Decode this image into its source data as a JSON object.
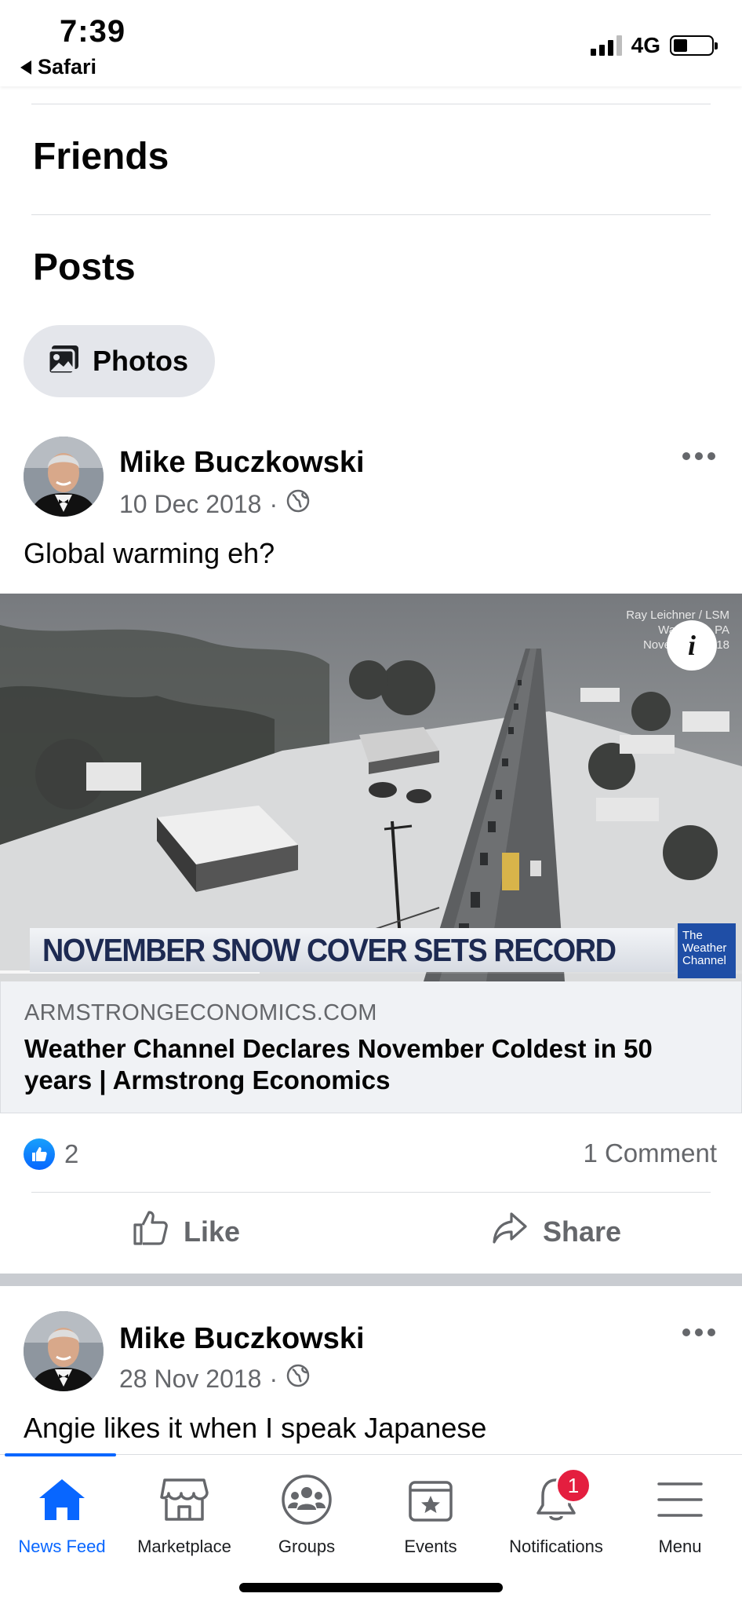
{
  "status_bar": {
    "time": "7:39",
    "back_app": "Safari",
    "network": "4G"
  },
  "profile_sections": {
    "friends": "Friends",
    "posts": "Posts",
    "photos_chip": "Photos"
  },
  "posts": [
    {
      "author": "Mike Buczkowski",
      "date": "10 Dec 2018",
      "separator": "·",
      "text": "Global warming eh?",
      "media": {
        "headline": "NOVEMBER SNOW COVER SETS RECORD",
        "credit_lines": [
          "Ray Leichner / LSM",
          "Wa            PA",
          "Novemb         18"
        ],
        "channel_logo": [
          "The",
          "Weather",
          "Channel"
        ],
        "info_label": "i",
        "video_progress": 0.35
      },
      "link": {
        "domain": "ARMSTRONGECONOMICS.COM",
        "title": "Weather Channel Declares November Coldest in 50 years | Armstrong Economics"
      },
      "reaction_count": "2",
      "comment_count": "1 Comment",
      "actions": {
        "like": "Like",
        "share": "Share"
      }
    },
    {
      "author": "Mike Buczkowski",
      "date": "28 Nov 2018",
      "separator": "·",
      "text": "Angie likes it when I speak Japanese"
    }
  ],
  "bottom_nav": {
    "items": [
      {
        "label": "News Feed",
        "icon": "home-icon",
        "active": true
      },
      {
        "label": "Marketplace",
        "icon": "marketplace-icon"
      },
      {
        "label": "Groups",
        "icon": "groups-icon"
      },
      {
        "label": "Events",
        "icon": "events-icon"
      },
      {
        "label": "Notifications",
        "icon": "bell-icon",
        "badge": "1"
      },
      {
        "label": "Menu",
        "icon": "menu-icon"
      }
    ]
  },
  "colors": {
    "accent": "#0866ff",
    "text_secondary": "#65676b",
    "badge": "#e41e3f",
    "chip_bg": "#e4e6eb",
    "link_card_bg": "#f0f2f5"
  }
}
